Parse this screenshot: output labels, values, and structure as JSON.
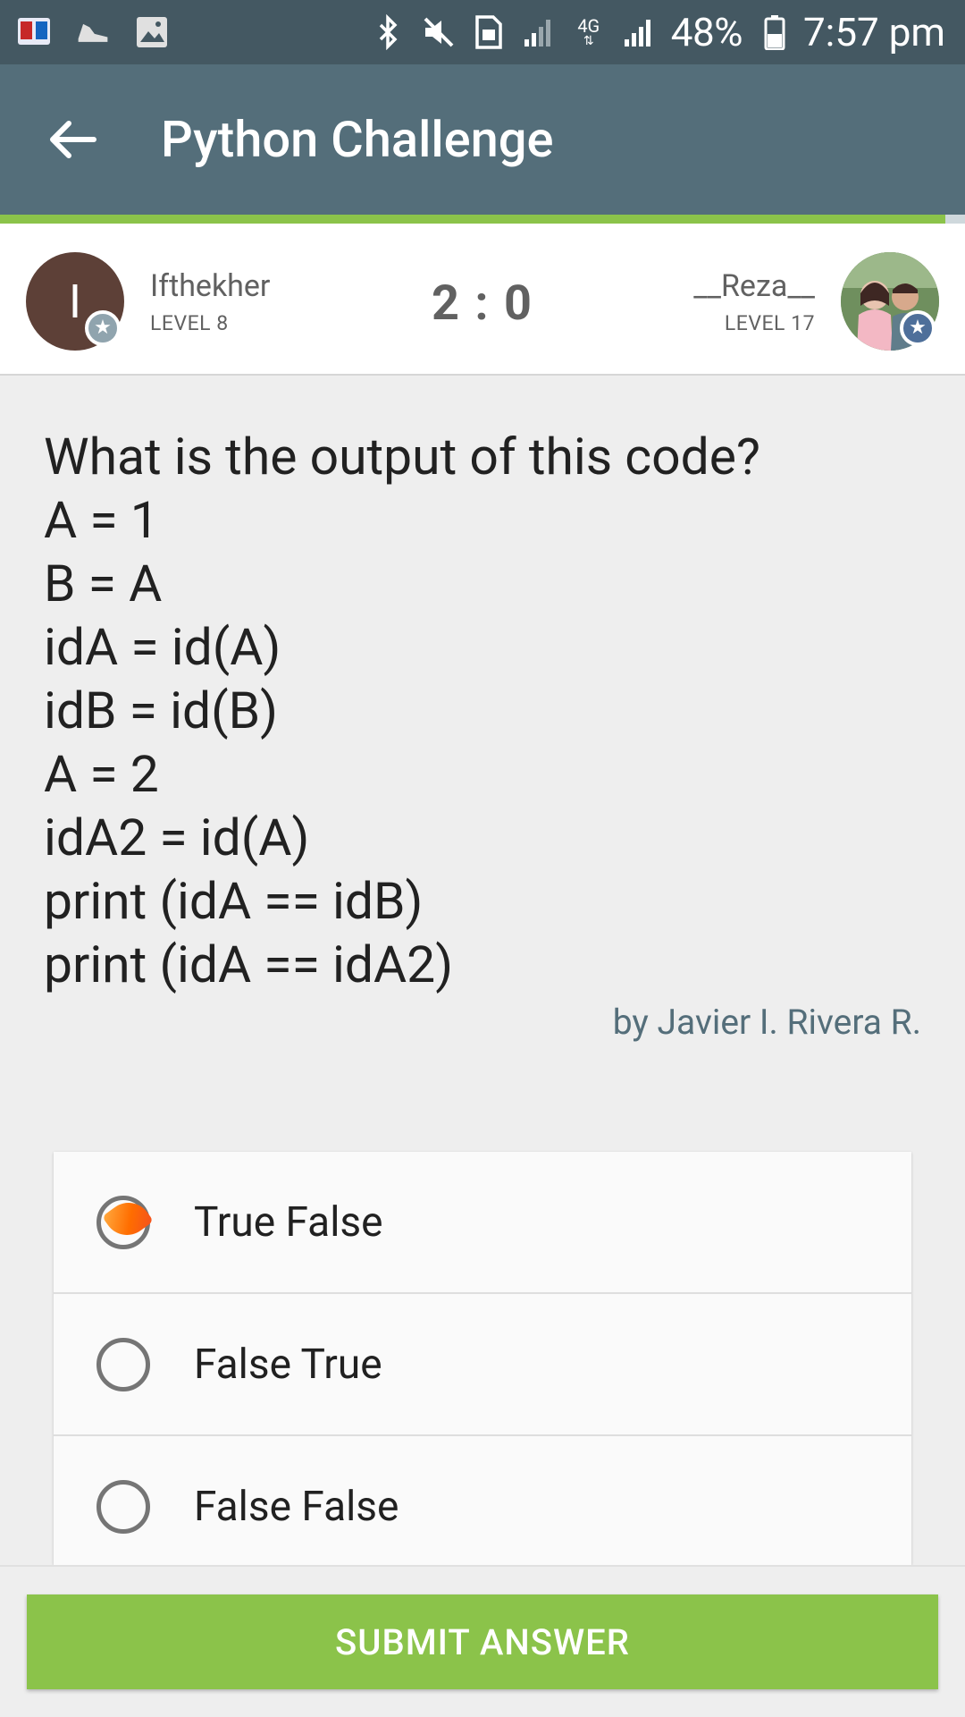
{
  "status_bar": {
    "battery_percent": "48%",
    "time": "7:57 pm",
    "network_label": "4G",
    "icons": [
      "dictionary-app-icon",
      "sneaker-icon",
      "image-icon",
      "bluetooth-icon",
      "mute-icon",
      "sim-icon",
      "signal-icon",
      "signal-4g-icon",
      "battery-icon"
    ]
  },
  "toolbar": {
    "title": "Python Challenge"
  },
  "players": {
    "left": {
      "initial": "I",
      "name": "Ifthekher",
      "level": "LEVEL 8"
    },
    "right": {
      "name": "__Reza__",
      "level": "LEVEL 17"
    },
    "score": "2 : 0"
  },
  "question": {
    "lines": [
      "What is the output of this code?",
      "A = 1",
      "B = A",
      "idA = id(A)",
      "idB = id(B)",
      "A = 2",
      "idA2 = id(A)",
      "print (idA == idB)",
      "print (idA == idA2)"
    ],
    "author": "by Javier I. Rivera R."
  },
  "answers": [
    {
      "label": "True False",
      "selected": true
    },
    {
      "label": "False True",
      "selected": false
    },
    {
      "label": "False False",
      "selected": false
    }
  ],
  "submit": {
    "label": "SUBMIT ANSWER"
  },
  "colors": {
    "status_bar": "#445862",
    "toolbar": "#546e7a",
    "accent_green": "#8bc34a",
    "selection_orange": "#ff6d00"
  }
}
